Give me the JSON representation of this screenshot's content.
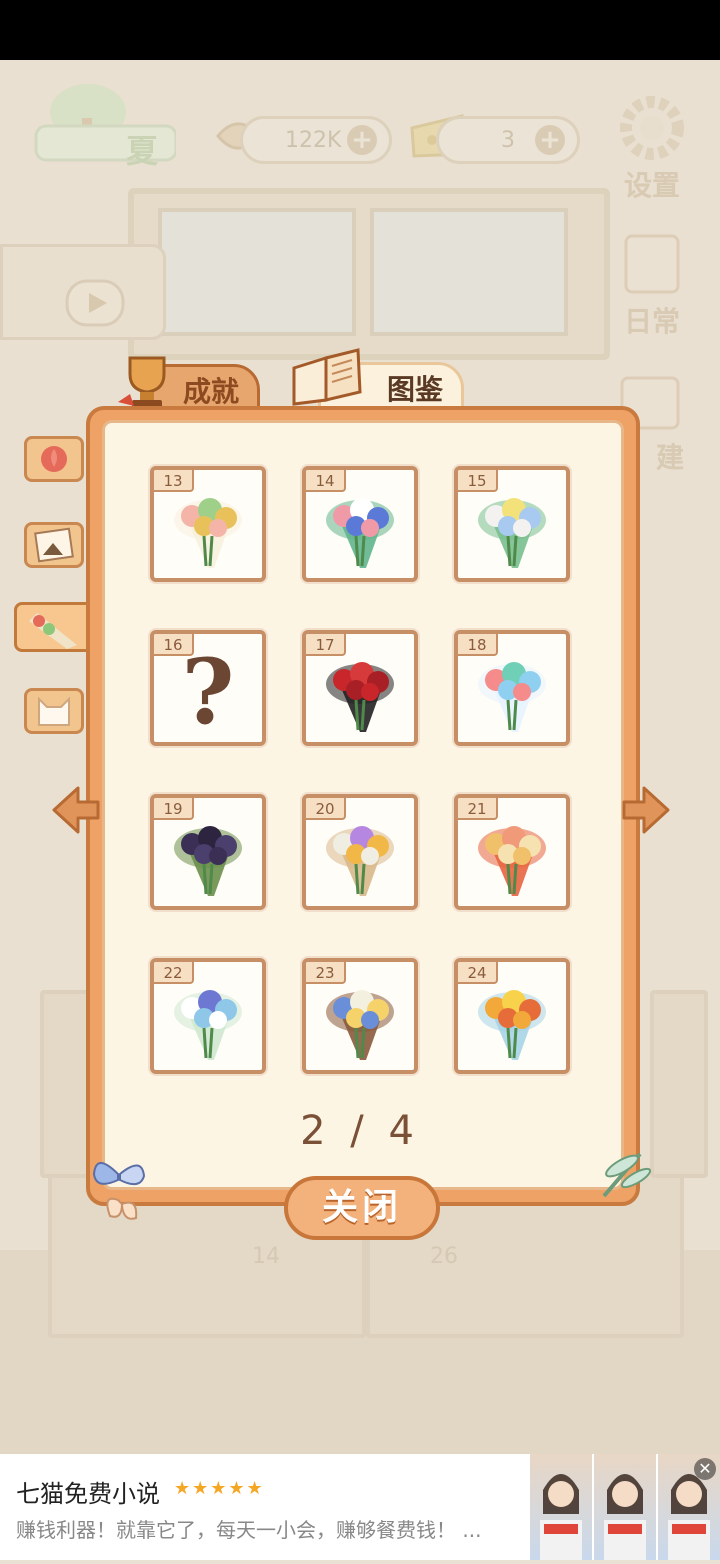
{
  "hud": {
    "season_label": "夏",
    "fish_value": "122K",
    "cheese_value": "3",
    "settings_label": "设置",
    "daily_label": "日常",
    "build_label": "建"
  },
  "background": {
    "table_numbers": [
      "14",
      "26"
    ]
  },
  "tabs": {
    "achievements": "成就",
    "collection": "图鉴"
  },
  "cards": [
    {
      "num": "13",
      "unknown": false
    },
    {
      "num": "14",
      "unknown": false
    },
    {
      "num": "15",
      "unknown": false
    },
    {
      "num": "16",
      "unknown": true,
      "symbol": "?"
    },
    {
      "num": "17",
      "unknown": false
    },
    {
      "num": "18",
      "unknown": false
    },
    {
      "num": "19",
      "unknown": false
    },
    {
      "num": "20",
      "unknown": false
    },
    {
      "num": "21",
      "unknown": false
    },
    {
      "num": "22",
      "unknown": false
    },
    {
      "num": "23",
      "unknown": false
    },
    {
      "num": "24",
      "unknown": false
    }
  ],
  "pagination": "2 / 4",
  "close_label": "关闭",
  "ad": {
    "title": "七猫免费小说",
    "stars": "★★★★★",
    "description": "赚钱利器！就靠它了，每天一小会，赚够餐费钱！ ...",
    "close_symbol": "✕"
  },
  "colors": {
    "panel": "#eea265",
    "panel_border": "#c97a3e",
    "inner": "#fdf5e4",
    "card_border": "#c78f66"
  }
}
